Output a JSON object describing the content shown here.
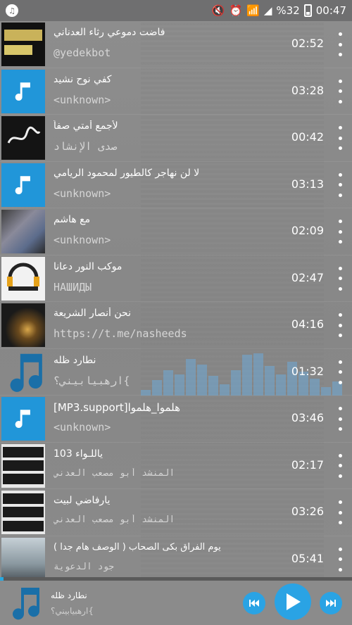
{
  "status_bar": {
    "battery": "%32",
    "time": "00:47"
  },
  "tracks": [
    {
      "title": "فاضت دموعي رثاء العدناني",
      "artist": "@yedekbot",
      "duration": "02:52"
    },
    {
      "title": "كفي نوح نشيد",
      "artist": "<unknown>",
      "duration": "03:28"
    },
    {
      "title": "لأجمع أمتي صفاً",
      "artist": "صدى الإنشاد",
      "duration": "00:42"
    },
    {
      "title": "لا لن نهاجر كالطيور لمحمود الريامي",
      "artist": "<unknown>",
      "duration": "03:13"
    },
    {
      "title": "مع هاشم",
      "artist": "<unknown>",
      "duration": "02:09"
    },
    {
      "title": "موكب النور دعانا",
      "artist": "НАШИДЫ",
      "duration": "02:47"
    },
    {
      "title": "نحن أنصار الشريعة",
      "artist": "https://t.me/nasheeds",
      "duration": "04:16"
    },
    {
      "title": "نطارد ظله",
      "artist": "ارهبيابيني؟{",
      "duration": "01:32"
    },
    {
      "title": "[MP3.support]هلموا_هلموا",
      "artist": "<unknown>",
      "duration": "03:46"
    },
    {
      "title": "ياللـواء 103",
      "artist": "المنشد أبو مصعب العدني",
      "duration": "02:17"
    },
    {
      "title": "يارفاضي لبيت",
      "artist": "المنشد أبو مصعب العدني",
      "duration": "03:26"
    },
    {
      "title": "يوم الفراق بكى الصحاب ( الوصف هام جدا )",
      "artist": "جود الدعوية",
      "duration": "05:41"
    }
  ],
  "now_playing": {
    "title": "نطارد ظله",
    "artist": "ارهبيابيني؟{",
    "progress": 0.0
  },
  "colors": {
    "accent": "#27a8e0"
  }
}
